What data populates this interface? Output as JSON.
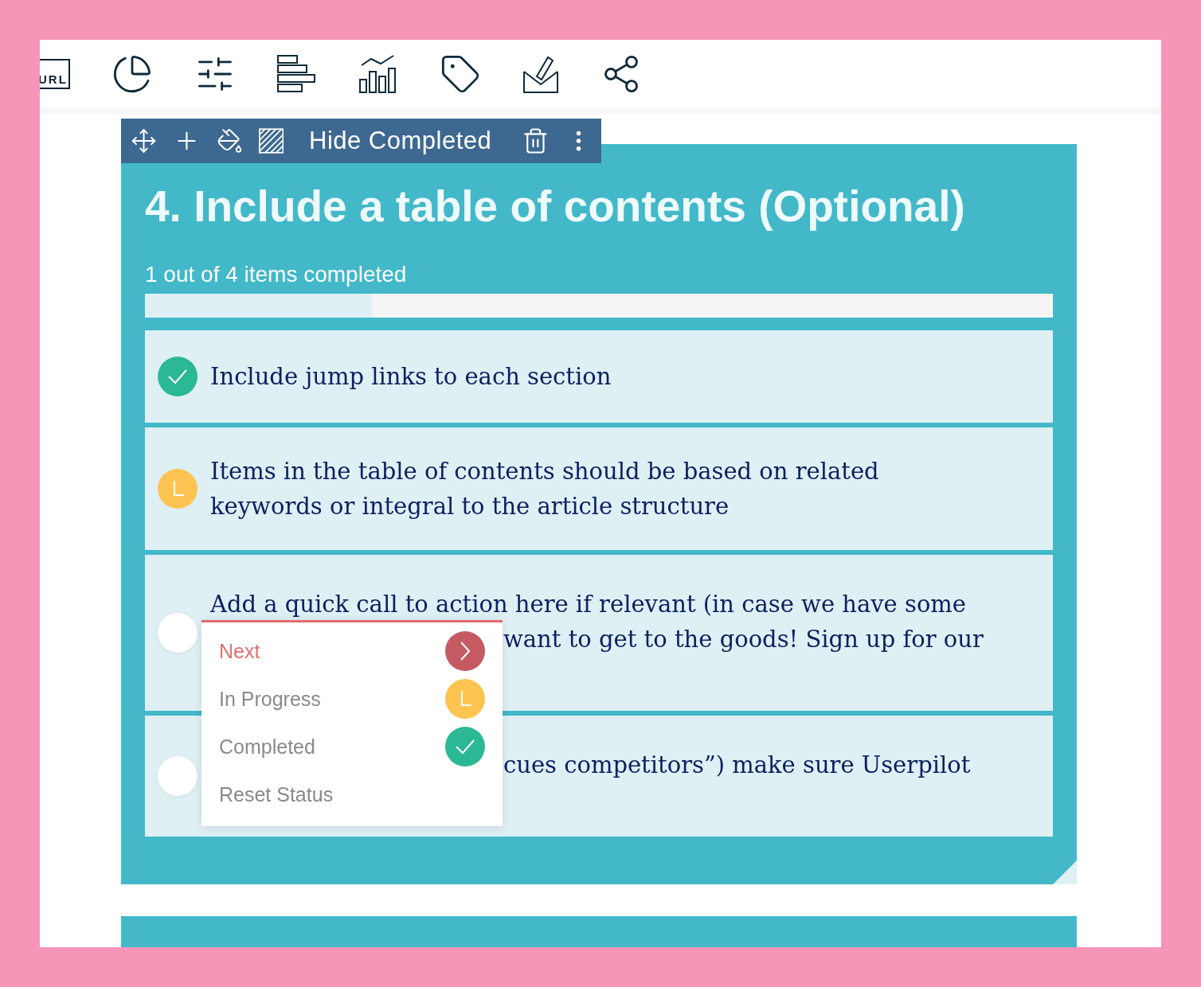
{
  "top_toolbar": {
    "url_label": "URL"
  },
  "block_toolbar": {
    "label": "Hide Completed"
  },
  "card": {
    "title": "4. Include a table of contents (Optional)",
    "progress_text": "1 out of 4 items completed",
    "progress": {
      "level": 0.25
    },
    "items": [
      {
        "kind": "completed",
        "lines": [
          {
            "text": "Include jump links to each section"
          }
        ]
      },
      {
        "kind": "in_progress",
        "lines": [
          {
            "text": "Items in the table of contents should be based on related"
          },
          {
            "text": "keywords or integral to the article structure"
          }
        ]
      },
      {
        "kind": "empty",
        "lines": [
          {
            "text": "Add a quick call to action here if relevant (in case we have some"
          },
          {
            "text": "want to get to the goods! Sign up for our",
            "covered": true
          }
        ]
      },
      {
        "kind": "empty",
        "lines": [
          {
            "text": "cues competitors”) make sure Userpilot",
            "covered": true
          }
        ]
      }
    ]
  },
  "status_menu": {
    "options": [
      {
        "label": "Next",
        "kind": "next",
        "selected": true
      },
      {
        "label": "In Progress",
        "kind": "in_progress",
        "selected": false
      },
      {
        "label": "Completed",
        "kind": "completed",
        "selected": false
      },
      {
        "label": "Reset Status",
        "kind": "reset",
        "selected": false
      }
    ]
  }
}
